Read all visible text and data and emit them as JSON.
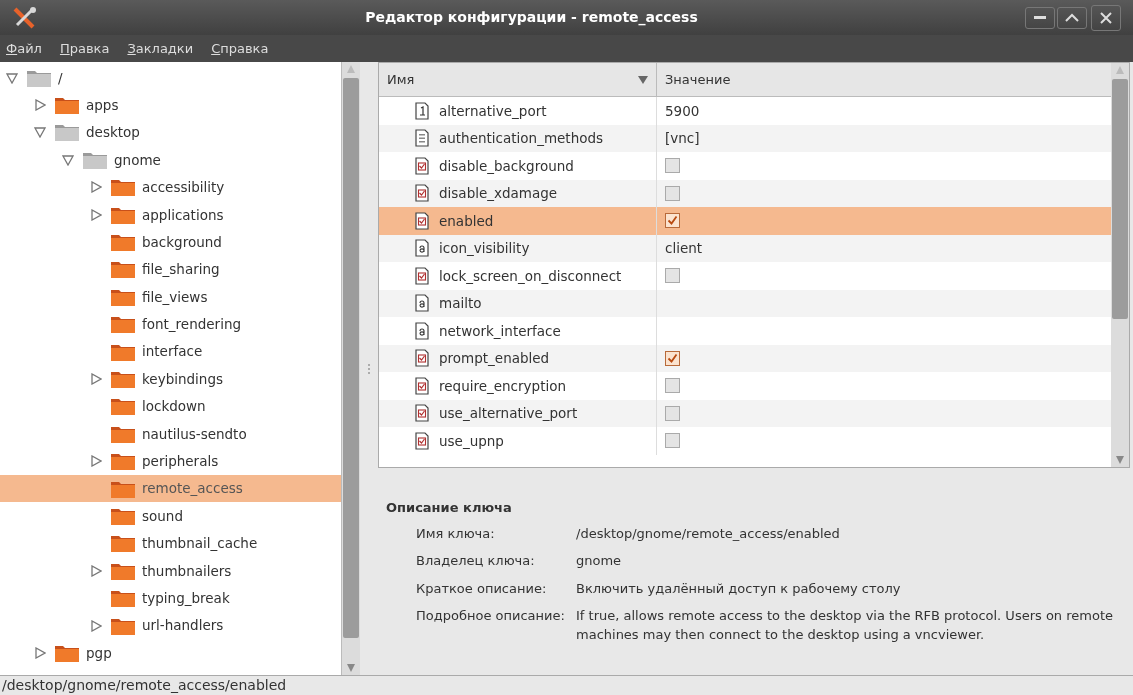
{
  "window": {
    "title": "Редактор конфигурации - remote_access"
  },
  "menu": [
    {
      "label": "Файл"
    },
    {
      "label": "Правка"
    },
    {
      "label": "Закладки"
    },
    {
      "label": "Справка"
    }
  ],
  "tree": [
    {
      "label": "/",
      "root": true,
      "expanded": true,
      "selected": false,
      "children": [
        {
          "label": "apps",
          "expanded": false,
          "selected": false
        },
        {
          "label": "desktop",
          "root": true,
          "expanded": true,
          "selected": false,
          "children": [
            {
              "label": "gnome",
              "root": true,
              "expanded": true,
              "selected": false,
              "children": [
                {
                  "label": "accessibility",
                  "expanded": false,
                  "selected": false
                },
                {
                  "label": "applications",
                  "expanded": false,
                  "selected": false
                },
                {
                  "label": "background",
                  "selected": false
                },
                {
                  "label": "file_sharing",
                  "selected": false
                },
                {
                  "label": "file_views",
                  "selected": false
                },
                {
                  "label": "font_rendering",
                  "selected": false
                },
                {
                  "label": "interface",
                  "selected": false
                },
                {
                  "label": "keybindings",
                  "expanded": false,
                  "selected": false
                },
                {
                  "label": "lockdown",
                  "selected": false
                },
                {
                  "label": "nautilus-sendto",
                  "selected": false
                },
                {
                  "label": "peripherals",
                  "expanded": false,
                  "selected": false
                },
                {
                  "label": "remote_access",
                  "selected": true
                },
                {
                  "label": "sound",
                  "selected": false
                },
                {
                  "label": "thumbnail_cache",
                  "selected": false
                },
                {
                  "label": "thumbnailers",
                  "expanded": false,
                  "selected": false
                },
                {
                  "label": "typing_break",
                  "selected": false
                },
                {
                  "label": "url-handlers",
                  "expanded": false,
                  "selected": false
                }
              ]
            }
          ]
        },
        {
          "label": "pgp",
          "expanded": false,
          "selected": false
        }
      ]
    }
  ],
  "table": {
    "columns": [
      "Имя",
      "Значение"
    ],
    "rows": [
      {
        "kind": "number",
        "name": "alternative_port",
        "value": "5900",
        "selected": false
      },
      {
        "kind": "list",
        "name": "authentication_methods",
        "value": "[vnc]",
        "selected": false
      },
      {
        "kind": "bool",
        "name": "disable_background",
        "checked": false,
        "selected": false
      },
      {
        "kind": "bool",
        "name": "disable_xdamage",
        "checked": false,
        "selected": false
      },
      {
        "kind": "bool",
        "name": "enabled",
        "checked": true,
        "selected": true
      },
      {
        "kind": "string",
        "name": "icon_visibility",
        "value": "client",
        "selected": false
      },
      {
        "kind": "bool",
        "name": "lock_screen_on_disconnect",
        "checked": false,
        "selected": false
      },
      {
        "kind": "string",
        "name": "mailto",
        "selected": false
      },
      {
        "kind": "string",
        "name": "network_interface",
        "selected": false
      },
      {
        "kind": "bool",
        "name": "prompt_enabled",
        "checked": true,
        "selected": false
      },
      {
        "kind": "bool",
        "name": "require_encryption",
        "checked": false,
        "selected": false
      },
      {
        "kind": "bool",
        "name": "use_alternative_port",
        "checked": false,
        "selected": false
      },
      {
        "kind": "bool",
        "name": "use_upnp",
        "checked": false,
        "selected": false
      }
    ]
  },
  "description": {
    "title": "Описание ключа",
    "fields": [
      {
        "label": "Имя ключа:",
        "value": "/desktop/gnome/remote_access/enabled"
      },
      {
        "label": "Владелец ключа:",
        "value": "gnome"
      },
      {
        "label": "Краткое описание:",
        "value": "Включить удалённый доступ к рабочему столу"
      },
      {
        "label": "Подробное описание:",
        "value": "If true, allows remote access to the desktop via the RFB protocol. Users on remote machines may then connect to the desktop using a vncviewer."
      }
    ]
  },
  "status_bar": "/desktop/gnome/remote_access/enabled"
}
